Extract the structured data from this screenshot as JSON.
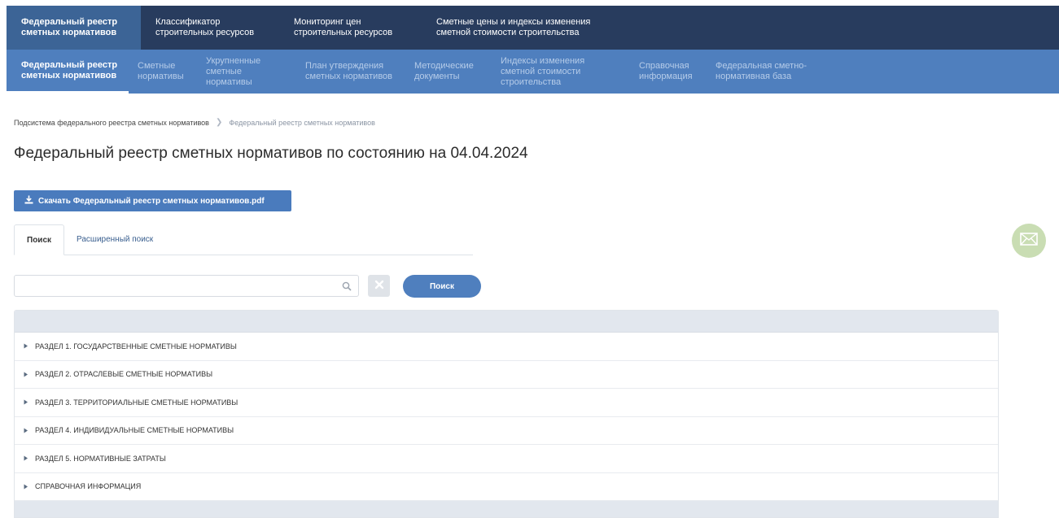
{
  "topnav": {
    "items": [
      {
        "label": "Федеральный реестр сметных нормативов"
      },
      {
        "label": "Классификатор строительных ресурсов"
      },
      {
        "label": "Мониторинг цен строительных ресурсов"
      },
      {
        "label": "Сметные цены и индексы изменения сметной стоимости строительства"
      }
    ]
  },
  "subnav": {
    "items": [
      {
        "label": "Федеральный реестр сметных нормативов"
      },
      {
        "label": "Сметные нормативы"
      },
      {
        "label": "Укрупненные сметные нормативы"
      },
      {
        "label": "План утверждения сметных нормативов"
      },
      {
        "label": "Методические документы"
      },
      {
        "label": "Индексы изменения сметной стоимости строительства"
      },
      {
        "label": "Справочная информация"
      },
      {
        "label": "Федеральная сметно-нормативная база"
      }
    ]
  },
  "breadcrumb": {
    "root": "Подсистема федерального реестра сметных нормативов",
    "current": "Федеральный реестр сметных нормативов"
  },
  "page": {
    "title": "Федеральный реестр сметных нормативов по состоянию на 04.04.2024",
    "download_label": "Скачать Федеральный реестр сметных нормативов.pdf"
  },
  "tabs": [
    {
      "label": "Поиск"
    },
    {
      "label": "Расширенный поиск"
    }
  ],
  "search": {
    "value": "",
    "placeholder": "",
    "button_label": "Поиск"
  },
  "tree": {
    "rows": [
      {
        "label": "РАЗДЕЛ 1. ГОСУДАРСТВЕННЫЕ СМЕТНЫЕ НОРМАТИВЫ"
      },
      {
        "label": "РАЗДЕЛ 2. ОТРАСЛЕВЫЕ СМЕТНЫЕ НОРМАТИВЫ"
      },
      {
        "label": "РАЗДЕЛ 3. ТЕРРИТОРИАЛЬНЫЕ СМЕТНЫЕ НОРМАТИВЫ"
      },
      {
        "label": "РАЗДЕЛ 4. ИНДИВИДУАЛЬНЫЕ СМЕТНЫЕ НОРМАТИВЫ"
      },
      {
        "label": "РАЗДЕЛ 5. НОРМАТИВНЫЕ ЗАТРАТЫ"
      },
      {
        "label": "СПРАВОЧНАЯ ИНФОРМАЦИЯ"
      }
    ]
  },
  "colors": {
    "topnav_bg": "#283c5e",
    "topnav_active": "#3c6496",
    "subnav_bg": "#4f7fbe",
    "accent": "#4a7bbd",
    "mail_fab": "#c9ddb3"
  },
  "icons": {
    "download": "download-icon",
    "search": "search-icon",
    "clear": "close-icon",
    "mail": "mail-icon",
    "row_arrow": "caret-right-icon"
  }
}
